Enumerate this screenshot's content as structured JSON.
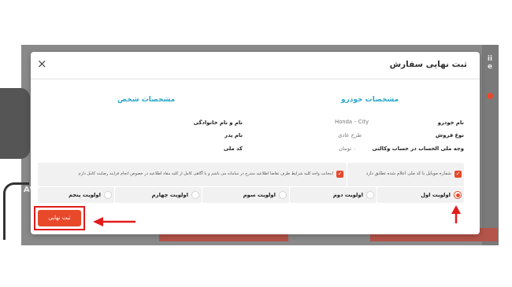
{
  "background": {
    "side_caption": "AW",
    "right_logo": "ii\ne"
  },
  "modal": {
    "title": "ثبت نهایی سفارش",
    "close_label": "×"
  },
  "vehicle_specs": {
    "title": "مشخصات خودرو",
    "rows": [
      {
        "label": "نام خودرو",
        "value": "Honda – City"
      },
      {
        "label": "نوع فروش",
        "value": "طرح عادی"
      },
      {
        "label": "وجه ملی الحساب در حساب وکالتی",
        "value": "۰ تومان"
      }
    ]
  },
  "personal_specs": {
    "title": "مشخصات شخص",
    "rows": [
      {
        "label": "نام و نام خانوادگی",
        "value": ""
      },
      {
        "label": "نام پدر",
        "value": ""
      },
      {
        "label": "کد ملی",
        "value": ""
      }
    ]
  },
  "consents": [
    {
      "text": "شماره موبایل با کد ملی اعلام شده تطابق دارد",
      "checked": true
    },
    {
      "text": "اینجانب واجد کلیه شرایط طرف تقاضا اطلاعیه مندرج در سامانه می باشم و با آگاهی کامل از کلیه مفاد اطلاعیه در خصوص انجام فرایند رضایت کامل دارم",
      "checked": true
    }
  ],
  "priorities": {
    "selected": 0,
    "options": [
      "اولویت اول",
      "اولویت دوم",
      "اولویت سوم",
      "اولویت چهارم",
      "اولویت پنجم"
    ]
  },
  "submit_label": "ثبت نهایی",
  "colors": {
    "accent": "#e8492b",
    "section_title": "#2aa6c9",
    "highlight_outline": "#e21b1b",
    "overlay": "#8a8a8a"
  }
}
